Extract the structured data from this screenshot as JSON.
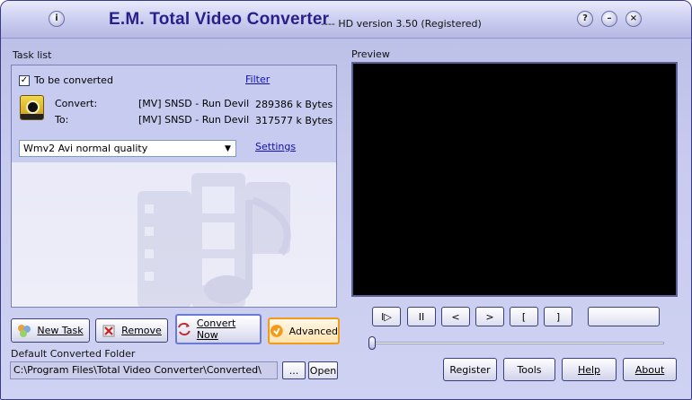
{
  "window": {
    "app_title": "E.M. Total Video Converter",
    "version": "----   HD version 3.50 (Registered)",
    "info_icon_glyph": "i",
    "help_icon_glyph": "?",
    "minimize_icon_glyph": "–",
    "close_icon_glyph": "×"
  },
  "task_list": {
    "label": "Task list",
    "task": {
      "checked": true,
      "checkbox_glyph": "✓",
      "title": "To be converted",
      "filter_link": "Filter",
      "convert_label": "Convert:",
      "convert_name": "[MV] SNSD - Run Devil",
      "convert_size": "289386 k Bytes",
      "to_label": "To:",
      "to_name": "[MV] SNSD - Run Devil",
      "to_size": "317577 k Bytes",
      "format_value": "Wmv2 Avi normal quality",
      "settings_link": "Settings"
    }
  },
  "actions": {
    "new_task": "New Task",
    "remove": "Remove",
    "convert_now": "Convert Now",
    "advanced": "Advanced"
  },
  "output": {
    "folder_label": "Default Converted Folder",
    "folder_path": "C:\\Program Files\\Total Video Converter\\Converted\\",
    "browse": "...",
    "open": "Open"
  },
  "preview": {
    "label": "Preview",
    "controls": [
      "I▷",
      "II",
      "<",
      ">",
      "[",
      "]"
    ],
    "position": 0
  },
  "bottom": {
    "register": "Register",
    "tools": "Tools",
    "help": "Help",
    "about": "About"
  },
  "colors": {
    "accent_title": "#2a1f8a",
    "link": "#1010b0",
    "advanced_border": "#f39b18",
    "task_row_bg": "#c7cbef"
  },
  "icons": {
    "info": "info-icon",
    "help": "help-icon",
    "minimize": "minimize-icon",
    "close": "close-icon",
    "video": "video-file-icon",
    "new_task": "new-task-icon",
    "remove": "remove-icon",
    "convert": "convert-icon",
    "advanced": "advanced-icon"
  }
}
